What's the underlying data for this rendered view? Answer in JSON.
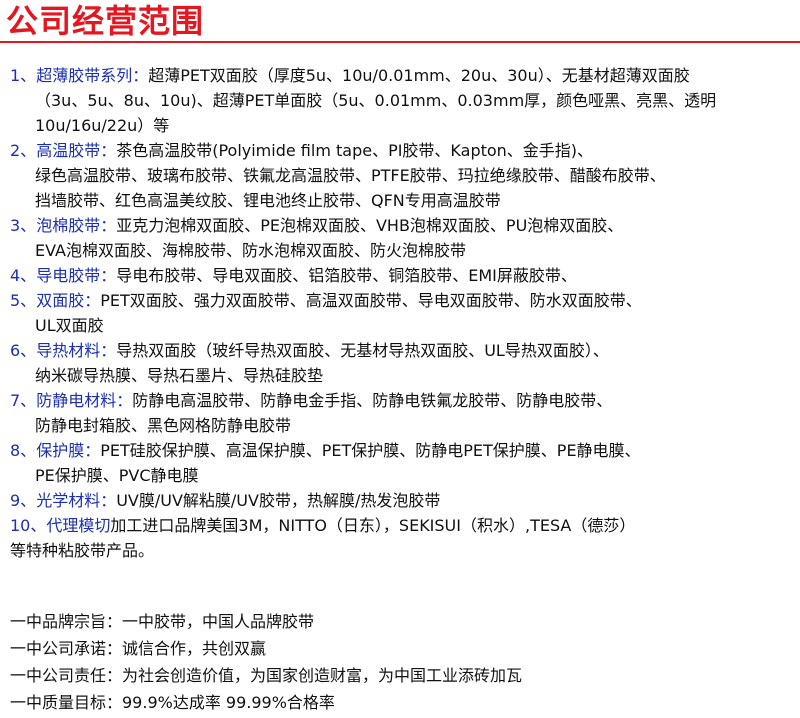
{
  "title": "公司经营范围",
  "items": [
    {
      "num": "1、",
      "label": "超薄胶带系列：",
      "lines": [
        "超薄PET双面胶（厚度5u、10u/0.01mm、20u、30u）、无基材超薄双面胶",
        "（3u、5u、8u、10u)、超薄PET单面胶（5u、0.01mm、0.03mm厚，颜色哑黑、亮黑、透明",
        "10u/16u/22u）等"
      ]
    },
    {
      "num": "2、",
      "label": "高温胶带：",
      "lines": [
        "茶色高温胶带(Polyimide film tape、PI胶带、Kapton、金手指)、",
        "绿色高温胶带、玻璃布胶带、铁氟龙高温胶带、PTFE胶带、玛拉绝缘胶带、醋酸布胶带、",
        "挡墙胶带、红色高温美纹胶、锂电池终止胶带、QFN专用高温胶带"
      ]
    },
    {
      "num": "3、",
      "label": "泡棉胶带：",
      "lines": [
        "亚克力泡棉双面胶、PE泡棉双面胶、VHB泡棉双面胶、PU泡棉双面胶、",
        "EVA泡棉双面胶、海棉胶带、防水泡棉双面胶、防火泡棉胶带"
      ]
    },
    {
      "num": "4、",
      "label": "导电胶带：",
      "lines": [
        "导电布胶带、导电双面胶、铝箔胶带、铜箔胶带、EMI屏蔽胶带、"
      ]
    },
    {
      "num": "5、",
      "label": "双面胶：",
      "lines": [
        "PET双面胶、强力双面胶带、高温双面胶带、导电双面胶带、防水双面胶带、",
        "UL双面胶"
      ]
    },
    {
      "num": "6、",
      "label": "导热材料：",
      "lines": [
        "导热双面胶（玻纤导热双面胶、无基材导热双面胶、UL导热双面胶）、",
        "纳米碳导热膜、导热石墨片、导热硅胶垫"
      ]
    },
    {
      "num": "7、",
      "label": "防静电材料：",
      "lines": [
        "防静电高温胶带、防静电金手指、防静电铁氟龙胶带、防静电胶带、",
        "防静电封箱胶、黑色网格防静电胶带"
      ]
    },
    {
      "num": "8、",
      "label": "保护膜：",
      "lines": [
        "PET硅胶保护膜、高温保护膜、PET保护膜、防静电PET保护膜、PE静电膜、",
        "PE保护膜、PVC静电膜"
      ]
    },
    {
      "num": "9、",
      "label": "光学材料：",
      "lines": [
        "UV膜/UV解粘膜/UV胶带，热解膜/热发泡胶带"
      ]
    },
    {
      "num": "10、",
      "label": "代理模切",
      "lines": [
        "加工进口品牌美国3M，NITTO（日东），SEKISUI（积水）,TESA（德莎）",
        "等特种粘胶带产品。"
      ]
    }
  ],
  "motto": [
    "一中品牌宗旨：一中胶带，中国人品牌胶带",
    "一中公司承诺：诚信合作，共创双赢",
    "一中公司责任：为社会创造价值，为国家创造财富，为中国工业添砖加瓦",
    "一中质量目标：99.9%达成率  99.99%合格率"
  ],
  "colors": {
    "title": "#e4161f",
    "label": "#1b2fb0",
    "text": "#111111"
  }
}
